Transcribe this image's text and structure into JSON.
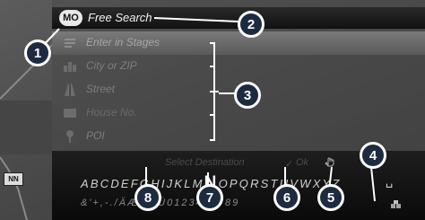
{
  "search": {
    "badge": "MO",
    "title": "Free Search"
  },
  "menu": {
    "items": [
      {
        "label": "Enter in Stages",
        "icon": "list-icon"
      },
      {
        "label": "City or ZIP",
        "icon": "city-icon"
      },
      {
        "label": "Street",
        "icon": "road-icon"
      },
      {
        "label": "House No.",
        "icon": "house-number-icon"
      },
      {
        "label": "POI",
        "icon": "pin-icon"
      }
    ]
  },
  "keyboard": {
    "hint_left": "Select Destination",
    "hint_right": "Ok",
    "row1_before": "ABCDEFGHIJKLM",
    "row1_active": "N",
    "row1_after": "OPQRSTUVWXYZ",
    "space_key": "␣",
    "row2": "&'+,-./ÄÆØÖÜ0123456789"
  },
  "map": {
    "road_label": "NN"
  },
  "callouts": [
    "1",
    "2",
    "3",
    "4",
    "5",
    "6",
    "7",
    "8"
  ],
  "colors": {
    "callout_fill": "#1d2b40",
    "callout_border": "#ffffff",
    "selected_row": "#6e6e6e"
  }
}
